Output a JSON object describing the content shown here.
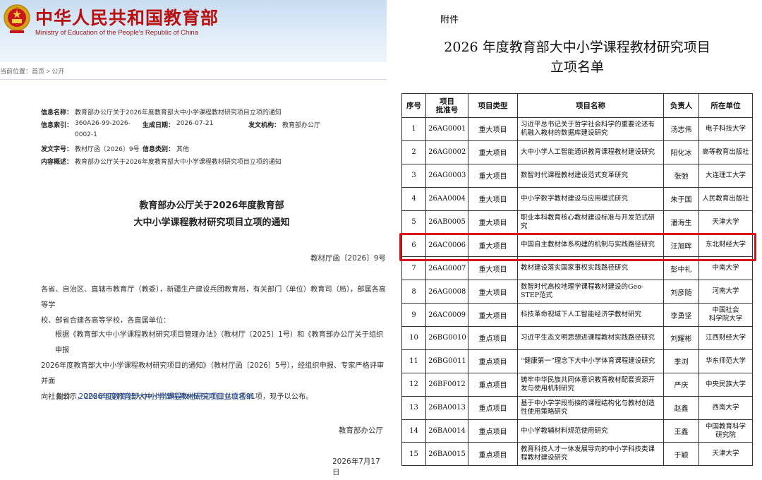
{
  "left": {
    "site_title": "中华人民共和国教育部",
    "site_subtitle": "Ministry of Education of the People's Republic of China",
    "breadcrumb": {
      "prefix": "当前位置：",
      "home": "首页",
      "sep1": " > ",
      "section": "公开"
    },
    "meta": {
      "name_label": "信息名称：",
      "name_value": "教育部办公厅关于2026年度教育部大中小学课程教材研究项目立项的通知",
      "index_label": "信息索引：",
      "index_value_1": "360A26-99-2026-",
      "index_value_2": "0002-1",
      "date_label": "生成日期：",
      "date_value": "2026-07-21",
      "org_label": "发文机构：",
      "org_value": "教育部办公厅",
      "num_label": "发文字号：",
      "num_value": "教材厅函〔2026〕9号",
      "cat_label": "信息类别：",
      "cat_value": "其他",
      "summary_label": "内容概述：",
      "summary_value": "教育部办公厅关于2026年度教育部大中小学课程教材研究项目立项的通知"
    },
    "doc_title_1": "教育部办公厅关于2026年度教育部",
    "doc_title_2": "大中小学课程教材研究项目立项的通知",
    "doc_number": "教材厅函〔2026〕9号",
    "recipients_1": "各省、自治区、直辖市教育厅（教委），新疆生产建设兵团教育局，有关部门（单位）教育司（局），部属各高等学",
    "recipients_2": "校、部省合建各高等学校，各直属单位：",
    "para_1": "根据《教育部大中小学课程教材研究项目管理办法》（教材厅〔2025〕1号）和《教育部办公厅关于组织申报",
    "para_2": "2026年度教育部大中小学课程教材研究项目的通知》（教材厅函〔2026〕5号），经组织申报、专家严格评审并面",
    "para_3": "向社会公示，2026年度教育部大中小学课程教材研究项目共立项91项，现予以公布。",
    "attach_prefix": "附件：",
    "attach_link": "2026年度教育部大中小学课程教材研究项目立项名单",
    "signature": "教育部办公厅",
    "sign_date": "2026年7月17日"
  },
  "right": {
    "fujian": "附件",
    "title_1": "2026 年度教育部大中小学课程教材研究项目",
    "title_2": "立项名单",
    "headers": [
      "序号",
      "项目\n批准号",
      "项目类型",
      "项目名称",
      "负责人",
      "所在单位"
    ],
    "rows": [
      [
        "1",
        "26AG0001",
        "重大项目",
        "习近平总书记关于哲学社会科学的重要论述有机融入教材的数据库建设研究",
        "汤志伟",
        "电子科技大学"
      ],
      [
        "2",
        "26AG0002",
        "重大项目",
        "大中小学人工智能通识教育课程教材建设研究",
        "阳化冰",
        "高等教育出版社"
      ],
      [
        "3",
        "26AG0003",
        "重大项目",
        "数智时代课程教材建设范式变革研究",
        "张弛",
        "大连理工大学"
      ],
      [
        "4",
        "26AA0004",
        "重大项目",
        "中小学数字教材建设与应用模式研究",
        "朱于国",
        "人民教育出版社"
      ],
      [
        "5",
        "26AB0005",
        "重大项目",
        "职业本科教育核心教材建设标准与开发范式研究",
        "潘海生",
        "天津大学"
      ],
      [
        "6",
        "26AC0006",
        "重大项目",
        "中国自主教材体系构建的机制与实践路径研究",
        "汪旭晖",
        "东北财经大学"
      ],
      [
        "7",
        "26AG0007",
        "重大项目",
        "教材建设落实国家事权实践路径研究",
        "彭中礼",
        "中南大学"
      ],
      [
        "8",
        "26AG0008",
        "重大项目",
        "数智时代高校地理学课程教材建设的Geo-STEP范式",
        "刘彦随",
        "河南大学"
      ],
      [
        "9",
        "26AC0009",
        "重大项目",
        "科技革命视域下人工智能经济学教材研究",
        "李勇坚",
        "中国社会\n科学院大学"
      ],
      [
        "10",
        "26BG0010",
        "重点项目",
        "习近平生态文明思想进课程教材实践路径研究",
        "刘耀彬",
        "江西财经大学"
      ],
      [
        "11",
        "26BG0011",
        "重点项目",
        "“健康第一”理念下大中小学体育课程建设研究",
        "季浏",
        "华东师范大学"
      ],
      [
        "12",
        "26BF0012",
        "重点项目",
        "铸牢中华民族共同体意识教育教材配套资源开发与使用机制研究",
        "严庆",
        "中央民族大学"
      ],
      [
        "13",
        "26BA0013",
        "重点项目",
        "基于中小学学段衔接的课程结构化与教材创造性使用策略研究",
        "赵鑫",
        "西南大学"
      ],
      [
        "14",
        "26BA0014",
        "重点项目",
        "中小学教辅材料规范使用研究",
        "王鑫",
        "中国教育科学\n研究院"
      ],
      [
        "15",
        "26BA0015",
        "重点项目",
        "教育科技人才一体发展导向的中小学科技类课程教材建设研究",
        "于颖",
        "天津大学"
      ]
    ],
    "highlight_color": "#d9141b"
  }
}
